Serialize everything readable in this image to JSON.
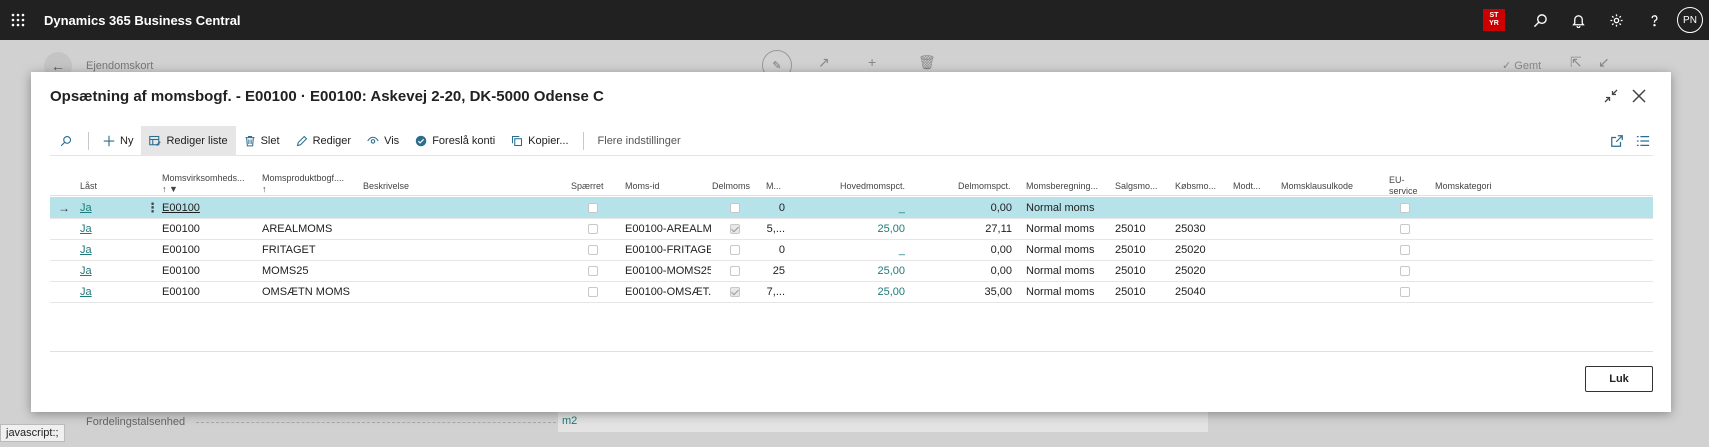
{
  "app": {
    "name": "Dynamics 365 Business Central",
    "badge_line1": "ST",
    "badge_line2": "YR",
    "avatar": "PN"
  },
  "background_page": {
    "title": "Ejendomskort",
    "saved": "Gemt",
    "field_label": "Fordelingstalsenhed",
    "field_value": "m2"
  },
  "status_bar": {
    "text": "javascript:;"
  },
  "dialog": {
    "title": "Opsætning af momsbogf. - E00100 · E00100: Askevej 2-20, DK-5000 Odense C",
    "close_button": "Luk"
  },
  "toolbar": {
    "new": "Ny",
    "edit_list": "Rediger liste",
    "delete": "Slet",
    "edit": "Rediger",
    "view": "Vis",
    "suggest_accounts": "Foreslå konti",
    "copy": "Kopier...",
    "more_options": "Flere indstillinger"
  },
  "columns": {
    "locked": "Låst",
    "bus_posting_group": "Momsvirksomheds...",
    "prod_posting_group": "Momsproduktbogf....",
    "description": "Beskrivelse",
    "blocked": "Spærret",
    "vat_id": "Moms-id",
    "partial_vat": "Delmoms",
    "m": "M...",
    "main_vat_pct": "Hovedmomspct.",
    "partial_vat_pct": "Delmomspct.",
    "vat_calc": "Momsberegning...",
    "sales_account": "Salgsmo...",
    "purchase_account": "Købsmo...",
    "reverse_account": "Modt...",
    "vat_clause": "Momsklausulkode",
    "eu_service_1": "EU-",
    "eu_service_2": "service",
    "vat_category": "Momskategori"
  },
  "rows": [
    {
      "locked": "Ja",
      "bus": "E00100",
      "prod": "",
      "desc": "",
      "blocked": false,
      "vat_id": "",
      "partial": false,
      "m": "0",
      "main_pct": "_",
      "partial_pct": "0,00",
      "calc": "Normal moms",
      "sales": "",
      "purchase": "",
      "reverse": "",
      "clause": "",
      "eu": false,
      "category": ""
    },
    {
      "locked": "Ja",
      "bus": "E00100",
      "prod": "AREALMOMS",
      "desc": "",
      "blocked": false,
      "vat_id": "E00100-AREALM...",
      "partial": true,
      "m": "5,...",
      "main_pct": "25,00",
      "partial_pct": "27,11",
      "calc": "Normal moms",
      "sales": "25010",
      "purchase": "25030",
      "reverse": "",
      "clause": "",
      "eu": false,
      "category": ""
    },
    {
      "locked": "Ja",
      "bus": "E00100",
      "prod": "FRITAGET",
      "desc": "",
      "blocked": false,
      "vat_id": "E00100-FRITAGET",
      "partial": false,
      "m": "0",
      "main_pct": "_",
      "partial_pct": "0,00",
      "calc": "Normal moms",
      "sales": "25010",
      "purchase": "25020",
      "reverse": "",
      "clause": "",
      "eu": false,
      "category": ""
    },
    {
      "locked": "Ja",
      "bus": "E00100",
      "prod": "MOMS25",
      "desc": "",
      "blocked": false,
      "vat_id": "E00100-MOMS25",
      "partial": false,
      "m": "25",
      "main_pct": "25,00",
      "partial_pct": "0,00",
      "calc": "Normal moms",
      "sales": "25010",
      "purchase": "25020",
      "reverse": "",
      "clause": "",
      "eu": false,
      "category": ""
    },
    {
      "locked": "Ja",
      "bus": "E00100",
      "prod": "OMSÆTN MOMS",
      "desc": "",
      "blocked": false,
      "vat_id": "E00100-OMSÆT...",
      "partial": true,
      "m": "7,...",
      "main_pct": "25,00",
      "partial_pct": "35,00",
      "calc": "Normal moms",
      "sales": "25010",
      "purchase": "25040",
      "reverse": "",
      "clause": "",
      "eu": false,
      "category": ""
    }
  ]
}
